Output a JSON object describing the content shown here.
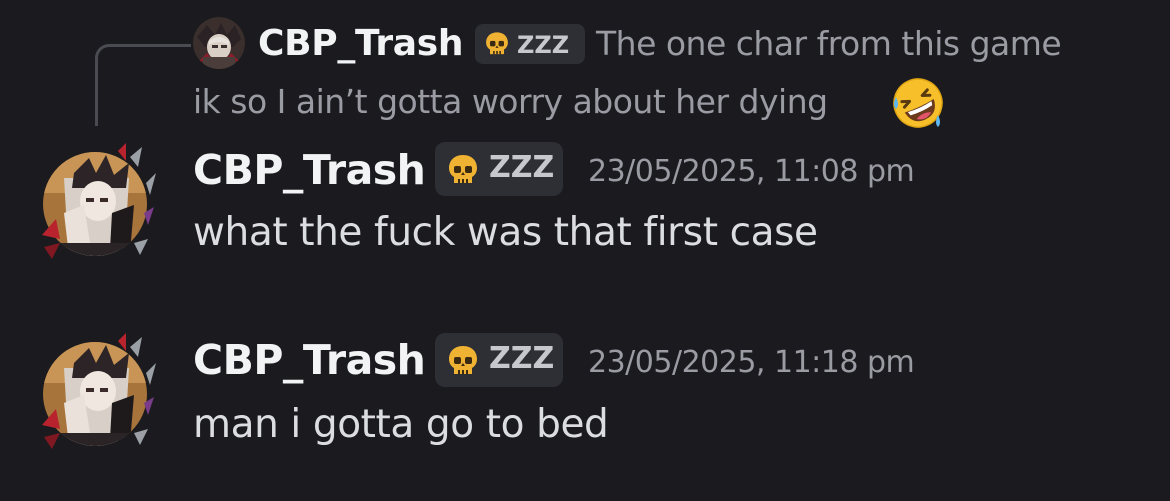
{
  "reply": {
    "username": "CBP_Trash",
    "tag": "ZZZ",
    "text_line1": "The one char from this game",
    "text_line2": "ik so I ain’t gotta worry about her dying",
    "emoji": "rolling-on-floor-laughing-emoji"
  },
  "messages": [
    {
      "username": "CBP_Trash",
      "tag": "ZZZ",
      "timestamp": "23/05/2025, 11:08 pm",
      "text": "what the fuck was that first case"
    },
    {
      "username": "CBP_Trash",
      "tag": "ZZZ",
      "timestamp": "23/05/2025, 11:18 pm",
      "text": "man i gotta go to bed"
    }
  ],
  "colors": {
    "background": "#1b1b1f",
    "username": "#f2f3f5",
    "muted_text": "#9a9ba3",
    "tag_background": "#2e2f35",
    "skull_icon": "#f0b232"
  },
  "icons": {
    "tag_icon": "skull-icon",
    "avatar": "avatar"
  }
}
